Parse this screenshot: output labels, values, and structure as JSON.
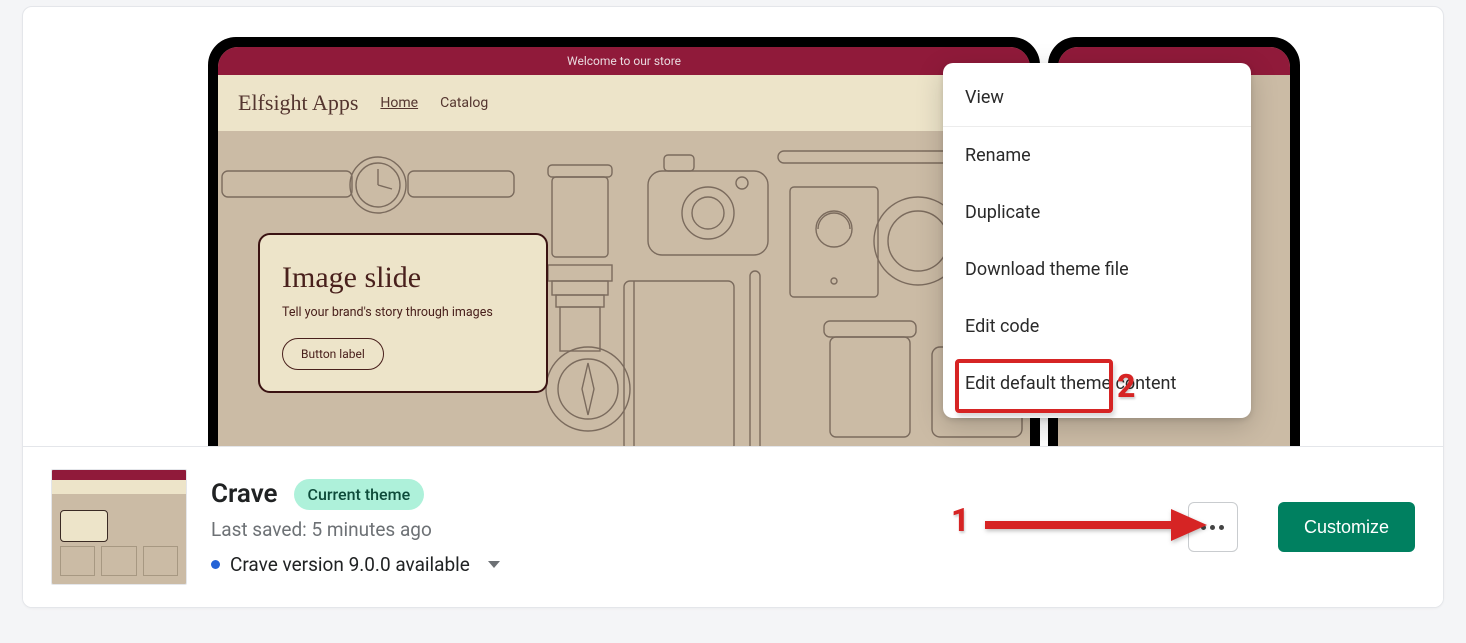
{
  "preview": {
    "topbar": "Welcome to our store",
    "brand": "Elfsight Apps",
    "nav": {
      "home": "Home",
      "catalog": "Catalog"
    },
    "slide": {
      "title": "Image slide",
      "subtitle": "Tell your brand's story through images",
      "button": "Button label"
    }
  },
  "menu": {
    "view": "View",
    "rename": "Rename",
    "duplicate": "Duplicate",
    "download": "Download theme file",
    "editcode": "Edit code",
    "editdefault": "Edit default theme content"
  },
  "theme": {
    "name": "Crave",
    "badge": "Current theme",
    "lastsaved": "Last saved: 5 minutes ago",
    "version": "Crave version 9.0.0 available"
  },
  "buttons": {
    "customize": "Customize"
  },
  "annotations": {
    "one": "1",
    "two": "2"
  }
}
